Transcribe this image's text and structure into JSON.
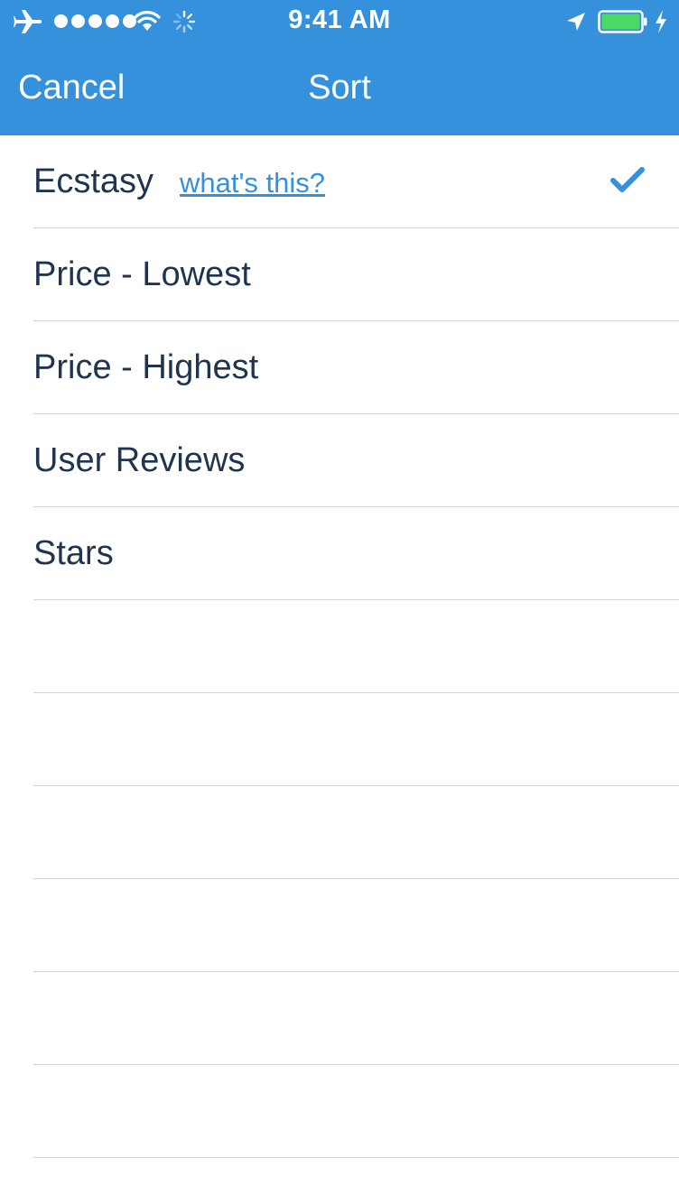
{
  "status_bar": {
    "time": "9:41 AM",
    "icons": [
      "airplane-icon",
      "signal-dots",
      "wifi-icon",
      "activity-spinner-icon",
      "location-arrow-icon",
      "battery-icon",
      "charging-bolt-icon"
    ]
  },
  "nav": {
    "cancel_label": "Cancel",
    "title": "Sort"
  },
  "sort_options": [
    {
      "label": "Ecstasy",
      "link": "what's this?",
      "selected": true
    },
    {
      "label": "Price - Lowest",
      "selected": false
    },
    {
      "label": "Price - Highest",
      "selected": false
    },
    {
      "label": "User Reviews",
      "selected": false
    },
    {
      "label": "Stars",
      "selected": false
    }
  ],
  "colors": {
    "header_bg": "#3591dc",
    "accent": "#3591dc",
    "text": "#1e3450",
    "separator": "#d4d4d8",
    "battery_fill": "#4cd964"
  }
}
